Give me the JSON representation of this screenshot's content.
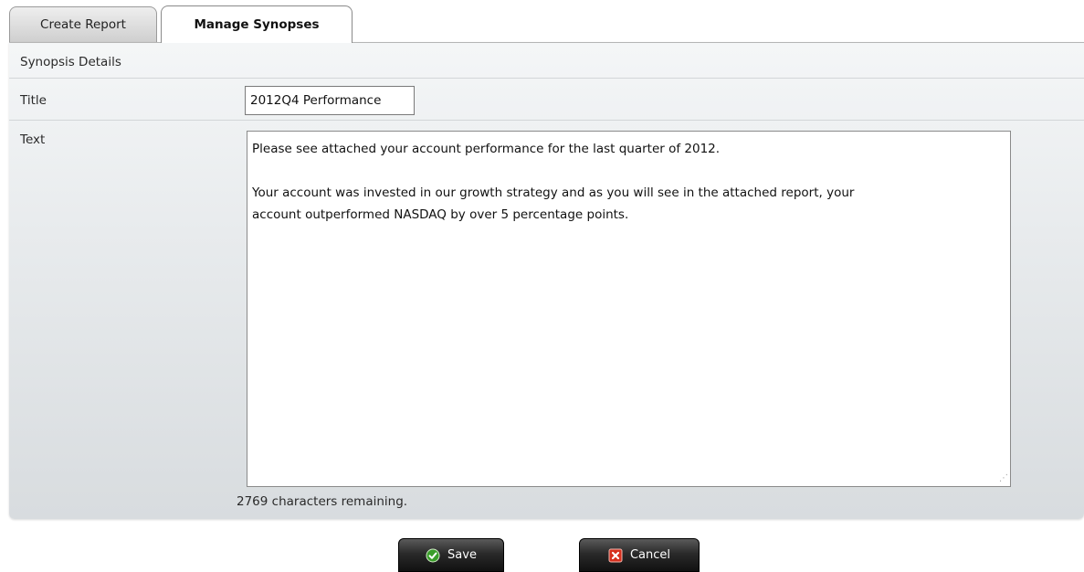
{
  "tabs": {
    "create_label": "Create Report",
    "manage_label": "Manage Synopses"
  },
  "panel": {
    "section_title": "Synopsis Details",
    "title_label": "Title",
    "title_value": "2012Q4 Performance",
    "text_label": "Text",
    "text_lines": [
      "Please see attached your account performance for the last quarter of 2012.",
      "Your account was invested in our growth strategy and as you will see in the attached report, your",
      "account outperformed NASDAQ by over 5 percentage points."
    ],
    "chars_remaining": "2769 characters remaining."
  },
  "actions": {
    "save_label": "Save",
    "cancel_label": "Cancel",
    "save_icon": "check-icon",
    "cancel_icon": "x-icon",
    "save_icon_color": "#3a9d2a",
    "cancel_icon_color": "#d6301e"
  }
}
